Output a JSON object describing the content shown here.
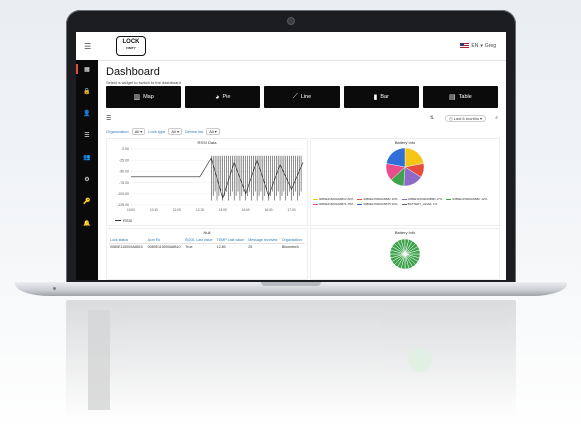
{
  "app": {
    "logo_main": "LOCK",
    "logo_sub": "FINITY",
    "language": "EN",
    "user": "Greg"
  },
  "sidebar": {
    "items": [
      {
        "icon": "dashboard-icon",
        "glyph": "▦"
      },
      {
        "icon": "lock-icon",
        "glyph": "🔒"
      },
      {
        "icon": "user-icon",
        "glyph": "👤"
      },
      {
        "icon": "list-icon",
        "glyph": "☰"
      },
      {
        "icon": "group-icon",
        "glyph": "👥"
      },
      {
        "icon": "settings-icon",
        "glyph": "⚙"
      },
      {
        "icon": "key-icon",
        "glyph": "🔑"
      },
      {
        "icon": "bell-icon",
        "glyph": "🔔"
      }
    ]
  },
  "page": {
    "title": "Dashboard",
    "subtitle": "Select a widget to switch to the dashboard"
  },
  "widgets": [
    {
      "label": "Map",
      "icon": "map-icon",
      "glyph": "▥"
    },
    {
      "label": "Pie",
      "icon": "pie-icon",
      "glyph": "◕"
    },
    {
      "label": "Line",
      "icon": "line-chart-icon",
      "glyph": "⟋"
    },
    {
      "label": "Bar",
      "icon": "bar-chart-icon",
      "glyph": "▮"
    },
    {
      "label": "Table",
      "icon": "table-icon",
      "glyph": "▤"
    }
  ],
  "toolbar": {
    "range": "Last 6 months"
  },
  "filters": [
    {
      "label": "Organization",
      "value": "All"
    },
    {
      "label": "Lock type",
      "value": "All"
    },
    {
      "label": "Device list",
      "value": "All"
    }
  ],
  "rssi_chart": {
    "title": "RSSI Data",
    "legend": "RSSI"
  },
  "chart_data": [
    {
      "type": "line",
      "title": "RSSI Data",
      "x": [
        "10:00",
        "10:05",
        "10:10",
        "11:00",
        "11:05",
        "12:10",
        "12:15",
        "13:00",
        "13:05",
        "15:00",
        "16:00",
        "16:15",
        "16:30",
        "16:45",
        "17:00",
        "17:05"
      ],
      "ylim": [
        -125,
        0
      ],
      "yticks": [
        -0.0,
        -25.0,
        -50.0,
        -75.0,
        -100.0,
        -125.0
      ],
      "series": [
        {
          "name": "RSSI",
          "values": [
            -62,
            -62,
            -62,
            -62,
            -62,
            -62,
            -62,
            -20,
            -110,
            -30,
            -100,
            -25,
            -105,
            -35,
            -90,
            -30
          ]
        }
      ],
      "grid": true,
      "legend": "bottom-left"
    },
    {
      "type": "pie",
      "title": "Battery Info",
      "series": [
        {
          "name": "0080E115000A6B10",
          "value": 22
        },
        {
          "name": "0080E115000A6B81",
          "value": 12
        },
        {
          "name": "0080E115000A6B9D",
          "value": 17
        },
        {
          "name": "0080E115000A6B8C",
          "value": 12
        },
        {
          "name": "0080E115000A6B74",
          "value": 15
        },
        {
          "name": "0080E115000A6B75",
          "value": 22
        }
      ],
      "legend": "bottom"
    },
    {
      "type": "pie",
      "title": "Battery Info",
      "series": [
        {
          "name": "",
          "value": 100
        }
      ]
    }
  ],
  "pie_legend": [
    {
      "label": "0080E115000A6B10 22%",
      "color": "#f5c518"
    },
    {
      "label": "0080E115000A6B81 12%",
      "color": "#e74c3c"
    },
    {
      "label": "0080E115000A6B9D 17%",
      "color": "#8e6ac8"
    },
    {
      "label": "0080E115000A6B8C 12%",
      "color": "#3fa34d"
    },
    {
      "label": "0080E115000A6B74 15%",
      "color": "#e84c8b"
    },
    {
      "label": "0080E115000A6B75 22%",
      "color": "#2f6fd6"
    },
    {
      "label": "BATTERY_LEVEL 1%",
      "color": "#666666"
    }
  ],
  "table": {
    "title": "Null",
    "columns": [
      "Lock status",
      "Acm Ek",
      "BOOL Last value",
      "TEMP Last value",
      "Message received",
      "Organization"
    ],
    "rows": [
      [
        "0080E115000A6B10",
        "0080E115000A6B10",
        "True",
        "12.80",
        "25",
        "Bloomtech"
      ]
    ]
  },
  "sunburst": {
    "title": "Battery Info"
  },
  "colors": {
    "sidebar": "#0a0a0a",
    "accent": "#e74c3c",
    "widget_bg": "#0b0b0b",
    "link_blue": "#2a7ab9",
    "battery_green": "#3fa34d"
  }
}
